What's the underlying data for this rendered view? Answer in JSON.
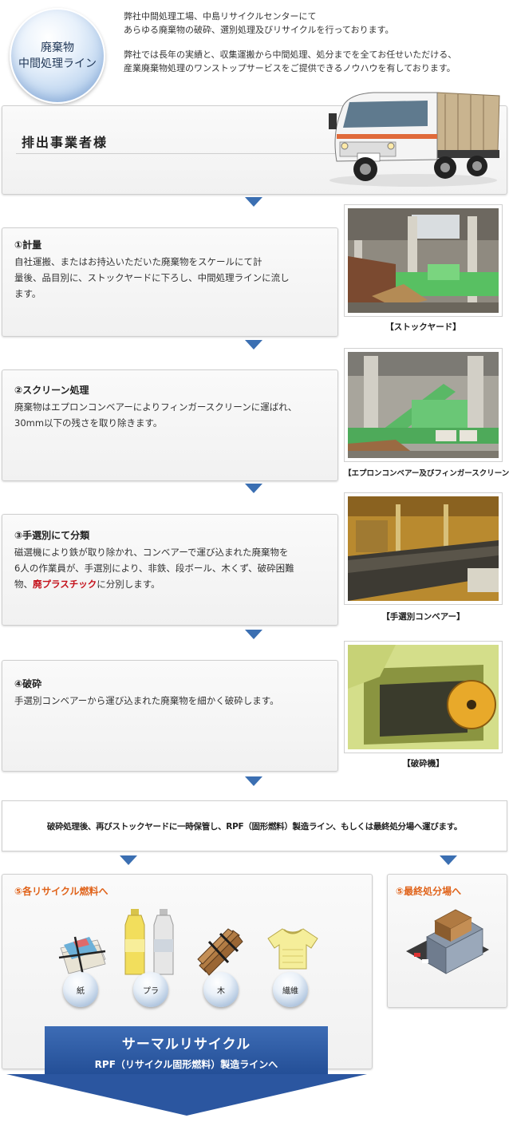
{
  "intro": {
    "badge_line1": "廃棄物",
    "badge_line2": "中間処理ライン",
    "para1_line1": "弊社中間処理工場、中島リサイクルセンターにて",
    "para1_line2": "あらゆる廃棄物の破砕、選別処理及びリサイクルを行っております。",
    "para2_line1": "弊社では長年の実績と、収集運搬から中間処理、処分までを全てお任せいただける、",
    "para2_line2": "産業廃棄物処理のワンストップサービスをご提供できるノウハウを有しております。"
  },
  "discharger": {
    "title": "排出事業者様"
  },
  "steps": [
    {
      "title": "①計量",
      "lines": [
        "自社運搬、またはお持込いただいた廃棄物をスケールにて計",
        "量後、品目別に、ストックヤードに下ろし、中間処理ラインに流し",
        "ます。"
      ],
      "caption": "【ストックヤード】"
    },
    {
      "title": "②スクリーン処理",
      "lines": [
        "廃棄物はエプロンコンベアーによりフィンガースクリーンに運ばれ、",
        "30mm以下の残さを取り除きます。"
      ],
      "caption": "【エプロンコンベアー及びフィンガースクリーン　】"
    },
    {
      "title": "③手選別にて分類",
      "lines": [
        "磁選機により鉄が取り除かれ、コンベアーで運び込まれた廃棄物を",
        "6人の作業員が、手選別により、非鉄、段ボール、木くず、破砕困難"
      ],
      "line3_prefix": "物、",
      "line3_emph": "廃プラスチック",
      "line3_suffix": "に分別します。",
      "caption": "【手選別コンベアー】"
    },
    {
      "title": "④破砕",
      "lines": [
        "手選別コンベアーから運び込まれた廃棄物を細かく破砕します。"
      ],
      "caption": "【破砕機】"
    }
  ],
  "after": {
    "text": "破砕処理後、再びストックヤードに一時保管し、RPF（固形燃料）製造ライン、もしくは最終処分場へ運びます。"
  },
  "recycle": {
    "heading": "⑤各リサイクル燃料へ",
    "items": [
      "紙",
      "プラ",
      "木",
      "繊維"
    ]
  },
  "final": {
    "heading": "⑤最終処分場へ"
  },
  "thermal": {
    "title": "サーマルリサイクル",
    "subtitle": "RPF（リサイクル固形燃料）製造ラインへ"
  },
  "colors": {
    "arrow": "#3b6fb2",
    "accent_orange": "#e0631a",
    "emphasis_red": "#c4111b",
    "band_blue": "#2b56a0"
  }
}
